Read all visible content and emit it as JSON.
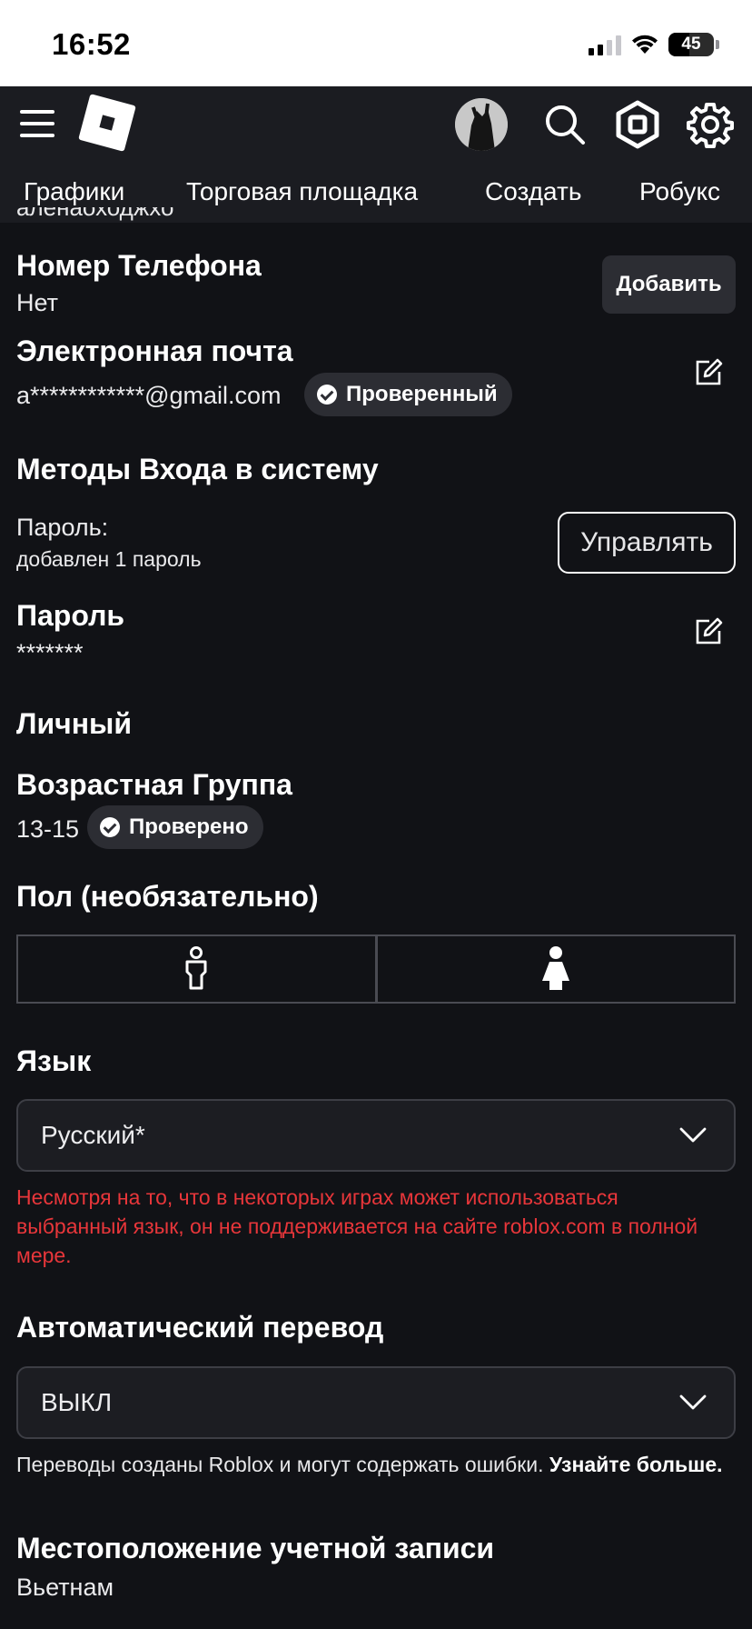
{
  "status_bar": {
    "time": "16:52",
    "battery_level": "45",
    "signal_bars": 2,
    "battery_fraction": 0.45
  },
  "header": {
    "icons": [
      "menu-icon",
      "roblox-logo",
      "avatar",
      "search-icon",
      "robux-icon",
      "gear-icon"
    ],
    "tabs": [
      "Графики",
      "Торговая площадка",
      "Создать",
      "Робукс"
    ]
  },
  "cutoff_text": "аленаоходжхо",
  "phone": {
    "title": "Номер Телефона",
    "value": "Нет",
    "add_button": "Добавить"
  },
  "email": {
    "title": "Электронная почта",
    "value": "a************@gmail.com",
    "badge": "Проверенный"
  },
  "login_methods": {
    "title": "Методы Входа в систему",
    "password_label": "Пароль:",
    "password_count": "добавлен 1 пароль",
    "manage_button": "Управлять"
  },
  "password": {
    "title": "Пароль",
    "value": "*******"
  },
  "personal": {
    "section_title": "Личный",
    "age_title": "Возрастная Группа",
    "age_value": "13-15",
    "age_badge": "Проверено",
    "gender_title": "Пол (необязательно)"
  },
  "language": {
    "title": "Язык",
    "selected": "Русский*",
    "warning": "Несмотря на то, что в некоторых играх может использоваться выбранный язык, он не поддерживается на сайте roblox.com в полной мере."
  },
  "auto_translate": {
    "title": "Автоматический перевод",
    "selected": "ВЫКЛ",
    "note": "Переводы созданы Roblox и могут содержать ошибки.",
    "learn_more": "Узнайте больше."
  },
  "location": {
    "title": "Местоположение учетной записи",
    "value": "Вьетнам"
  },
  "colors": {
    "background": "#111216",
    "nav": "#1b1c21",
    "badge": "#2c2d33",
    "warning": "#e8363a"
  }
}
